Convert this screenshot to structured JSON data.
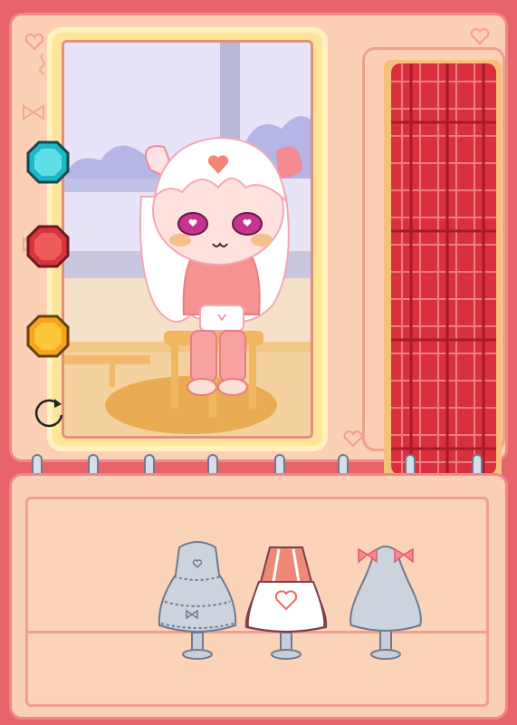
{
  "game": {
    "title": ""
  },
  "colors": {
    "background": "#e8646a",
    "panel": "#fbd0b4",
    "frame": "#ffe59a",
    "plaid": "#d8303c"
  },
  "gem_buttons": [
    {
      "name": "teal-gem",
      "color": "#1cb8c8"
    },
    {
      "name": "red-gem",
      "color": "#d8343e"
    },
    {
      "name": "orange-gem",
      "color": "#f7a41c"
    }
  ],
  "outfits": [
    {
      "name": "frilly-lolita-dress",
      "color": "#ccd3dd"
    },
    {
      "name": "heart-apron-dress",
      "color": "#f08878"
    },
    {
      "name": "bow-simple-dress",
      "color": "#ccd3dd"
    }
  ],
  "icons": {
    "rotate": "rotate-icon",
    "heart": "heart-icon",
    "bow": "bow-icon"
  }
}
